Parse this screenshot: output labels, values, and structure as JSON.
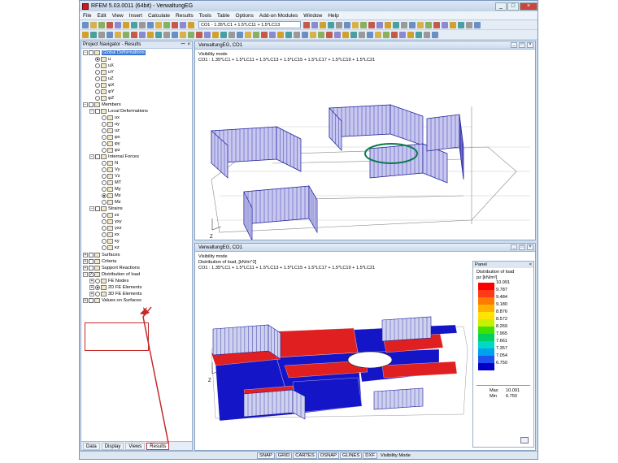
{
  "window": {
    "title": "RFEM 5.03.0011 (64bit) - VerwaltungEG",
    "buttons": [
      "_",
      "□",
      "×"
    ]
  },
  "menu": [
    "File",
    "Edit",
    "View",
    "Insert",
    "Calculate",
    "Results",
    "Tools",
    "Table",
    "Options",
    "Add-on Modules",
    "Window",
    "Help"
  ],
  "toolbar": {
    "load_combo": "CO1 - 1.35*LC1 + 1.5*LC11 + 1.5*LC13"
  },
  "navigator": {
    "title": "Project Navigator - Results",
    "header_buttons": [
      "ꟷ",
      "×"
    ],
    "tree": [
      {
        "level": 0,
        "exp": "−",
        "ctl": "chk",
        "ctl_state": "",
        "label": "Global Deformations",
        "selected": true
      },
      {
        "level": 1,
        "ctl": "rad",
        "on": true,
        "label": "u"
      },
      {
        "level": 1,
        "ctl": "rad",
        "label": "uX"
      },
      {
        "level": 1,
        "ctl": "rad",
        "label": "uY"
      },
      {
        "level": 1,
        "ctl": "rad",
        "label": "uZ"
      },
      {
        "level": 1,
        "ctl": "rad",
        "label": "φX"
      },
      {
        "level": 1,
        "ctl": "rad",
        "label": "φY"
      },
      {
        "level": 1,
        "ctl": "rad",
        "label": "φZ"
      },
      {
        "level": 0,
        "exp": "−",
        "ctl": "chk",
        "ctl_state": "",
        "label": "Members"
      },
      {
        "level": 1,
        "exp": "−",
        "ctl": "chk",
        "ctl_state": "",
        "label": "Local Deformations"
      },
      {
        "level": 2,
        "ctl": "rad",
        "label": "ux"
      },
      {
        "level": 2,
        "ctl": "rad",
        "label": "uy"
      },
      {
        "level": 2,
        "ctl": "rad",
        "label": "uz"
      },
      {
        "level": 2,
        "ctl": "rad",
        "label": "φx"
      },
      {
        "level": 2,
        "ctl": "rad",
        "label": "φy"
      },
      {
        "level": 2,
        "ctl": "rad",
        "label": "φz"
      },
      {
        "level": 1,
        "exp": "−",
        "ctl": "chk",
        "ctl_state": "",
        "label": "Internal Forces"
      },
      {
        "level": 2,
        "ctl": "rad",
        "label": "N"
      },
      {
        "level": 2,
        "ctl": "rad",
        "label": "Vy"
      },
      {
        "level": 2,
        "ctl": "rad",
        "label": "Vz"
      },
      {
        "level": 2,
        "ctl": "rad",
        "label": "MT"
      },
      {
        "level": 2,
        "ctl": "rad",
        "label": "My"
      },
      {
        "level": 2,
        "ctl": "rad",
        "on": true,
        "label": "Mz"
      },
      {
        "level": 2,
        "ctl": "rad",
        "label": "Mz"
      },
      {
        "level": 1,
        "exp": "−",
        "ctl": "chk",
        "ctl_state": "",
        "label": "Strains"
      },
      {
        "level": 2,
        "ctl": "rad",
        "label": "εx"
      },
      {
        "level": 2,
        "ctl": "rad",
        "label": "γxy"
      },
      {
        "level": 2,
        "ctl": "rad",
        "label": "γxz"
      },
      {
        "level": 2,
        "ctl": "rad",
        "label": "κx"
      },
      {
        "level": 2,
        "ctl": "rad",
        "label": "κy"
      },
      {
        "level": 2,
        "ctl": "rad",
        "label": "κz"
      },
      {
        "level": 0,
        "exp": "+",
        "ctl": "chk",
        "ctl_state": "",
        "label": "Surfaces"
      },
      {
        "level": 0,
        "exp": "+",
        "ctl": "chk",
        "ctl_state": "",
        "label": "Criteria"
      },
      {
        "level": 0,
        "exp": "+",
        "ctl": "chk",
        "ctl_state": "",
        "label": "Support Reactions"
      },
      {
        "level": 0,
        "exp": "−",
        "ctl": "chk",
        "ctl_state": "✓",
        "label": "Distribution of load"
      },
      {
        "level": 1,
        "exp": "+",
        "ctl": "rad",
        "label": "FE Nodes"
      },
      {
        "level": 1,
        "exp": "+",
        "ctl": "rad",
        "on": true,
        "label": "2D FE Elements"
      },
      {
        "level": 1,
        "exp": "+",
        "ctl": "rad",
        "label": "3D FE Elements"
      },
      {
        "level": 0,
        "exp": "+",
        "ctl": "chk",
        "ctl_state": "",
        "label": "Values on Surfaces"
      }
    ],
    "tabs": [
      "Data",
      "Display",
      "Views",
      "Results"
    ]
  },
  "view1": {
    "title": "VerwaltungEG, CO1",
    "lines": [
      "Visibility mode",
      "CO1 : 1.35*LC1 + 1.5*LC11 + 1.5*LC13 + 1.5*LC15 + 1.5*LC17 + 1.5*LC19 + 1.5*LC21"
    ],
    "axis": "Z"
  },
  "view2": {
    "title": "VerwaltungEG, CO1",
    "lines": [
      "Visibility mode",
      "Distribution of load, [kN/m^2]",
      "CO1 : 1.35*LC1 + 1.5*LC11 + 1.5*LC13 + 1.5*LC15 + 1.5*LC17 + 1.5*LC19 + 1.5*LC21"
    ],
    "axis": "Z"
  },
  "panel": {
    "title": "Panel",
    "close": "×",
    "heading": "Distribution of load",
    "unit": "pz [kN/m²]",
    "legend": [
      {
        "value": "10.091",
        "color": "#ff0000"
      },
      {
        "value": "9.787",
        "color": "#ff3a1a"
      },
      {
        "value": "9.484",
        "color": "#ff7a00"
      },
      {
        "value": "9.180",
        "color": "#ffb000"
      },
      {
        "value": "8.876",
        "color": "#ffe400"
      },
      {
        "value": "8.572",
        "color": "#c8f000"
      },
      {
        "value": "8.269",
        "color": "#40e000"
      },
      {
        "value": "7.965",
        "color": "#00d060"
      },
      {
        "value": "7.661",
        "color": "#00d8c8"
      },
      {
        "value": "7.357",
        "color": "#00a0f0"
      },
      {
        "value": "7.054",
        "color": "#2050f0"
      },
      {
        "value": "6.750",
        "color": "#0000c8"
      }
    ],
    "max_label": "Max",
    "max_value": "10.091",
    "min_label": "Min",
    "min_value": "6.750"
  },
  "statusbar": {
    "buttons": [
      "SNAP",
      "GRID",
      "CARTES",
      "OSNAP",
      "GLINES",
      "DXF"
    ],
    "mode": "Visibility Mode"
  }
}
